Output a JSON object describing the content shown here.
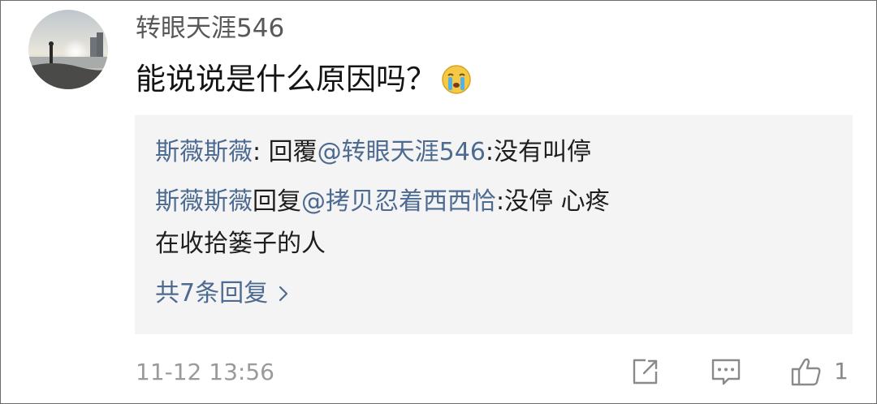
{
  "comment": {
    "username": "转眼天涯546",
    "text": "能说说是什么原因吗？",
    "emoji": "crying-face-icon",
    "timestamp": "11-12 13:56",
    "like_count": "1"
  },
  "replies": [
    {
      "author": "斯薇斯薇",
      "separator": ": ",
      "verb": "回覆",
      "mention": "@转眼天涯546",
      "text": ":没有叫停"
    },
    {
      "author": "斯薇斯薇",
      "separator": "",
      "verb": "回复",
      "mention": "@拷贝忍着西西恰",
      "text": ":没停 心疼",
      "text_line2": "在收拾篓子的人"
    }
  ],
  "more_replies_label": "共7条回复",
  "icons": {
    "share": "share-icon",
    "reply": "comment-icon",
    "like": "thumbs-up-icon",
    "more": "chevron-right-icon"
  },
  "colors": {
    "link": "#4d6a90",
    "reply_bg": "#f4f4f4",
    "username": "#585858",
    "timestamp": "#9a9a9a"
  }
}
